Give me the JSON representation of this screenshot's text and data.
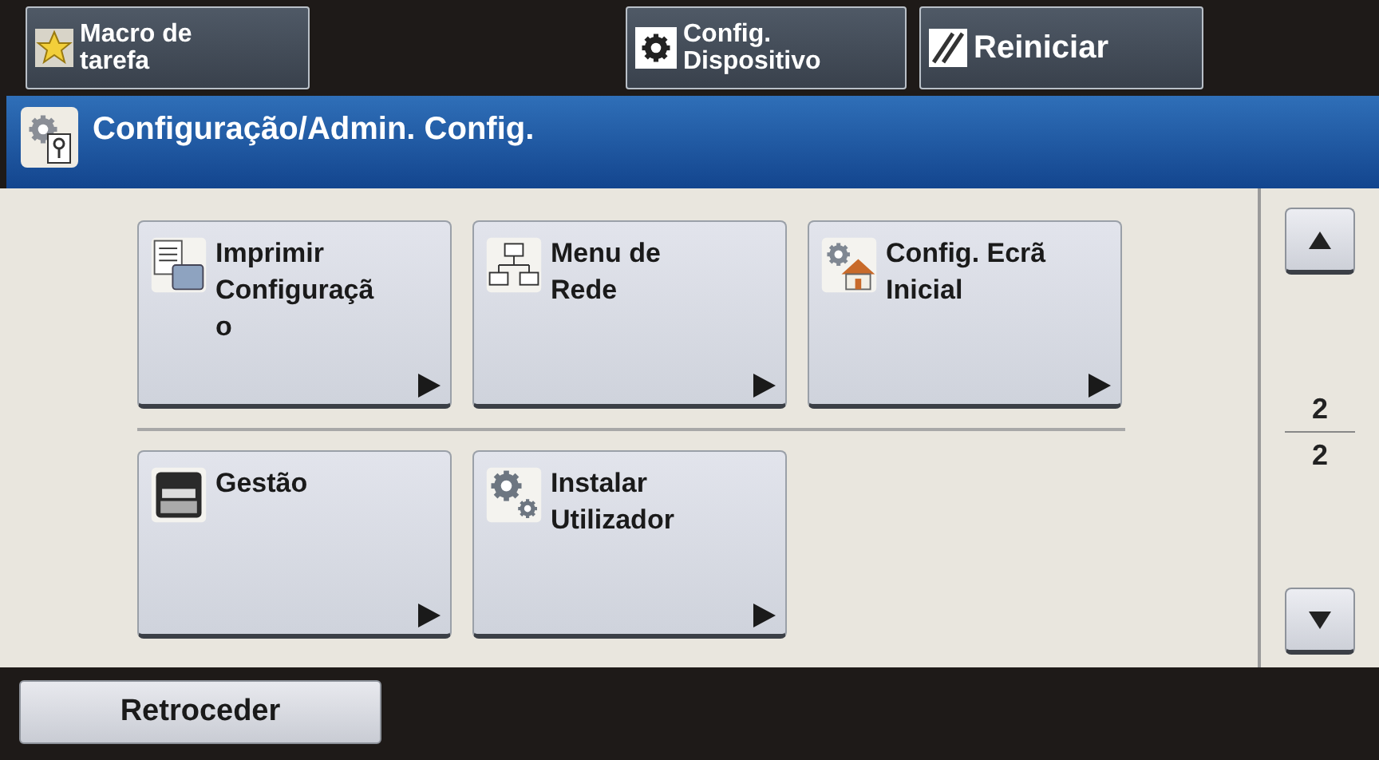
{
  "top_buttons": [
    {
      "kind": "star",
      "lines": [
        "Macro de",
        "tarefa"
      ]
    },
    {
      "kind": "gear",
      "lines": [
        "Config.",
        "Dispositivo"
      ]
    },
    {
      "kind": "reset",
      "lines": [
        "Reiniciar"
      ]
    }
  ],
  "title_bar": {
    "title": "Configuração/Admin. Config."
  },
  "tiles": [
    {
      "kind": "document",
      "lines": [
        "Imprimir",
        "Configuraçã",
        "o"
      ]
    },
    {
      "kind": "network",
      "lines": [
        "Menu de",
        "Rede"
      ]
    },
    {
      "kind": "home",
      "lines": [
        "Config. Ecrã",
        "Inicial"
      ]
    },
    {
      "kind": "printer",
      "lines": [
        "Gestão"
      ]
    },
    {
      "kind": "gears",
      "lines": [
        "Instalar",
        "Utilizador"
      ]
    }
  ],
  "pager": {
    "current": "2",
    "total": "2"
  },
  "back_button": {
    "label": "Retroceder"
  }
}
